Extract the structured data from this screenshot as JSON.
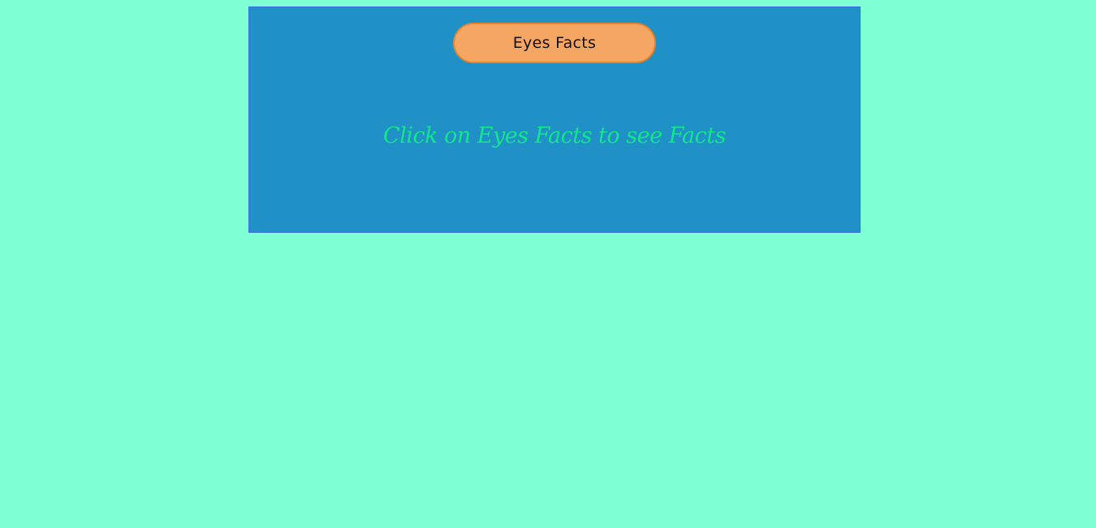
{
  "card": {
    "button_label": "Eyes Facts",
    "message": "Click on Eyes Facts to see Facts"
  }
}
